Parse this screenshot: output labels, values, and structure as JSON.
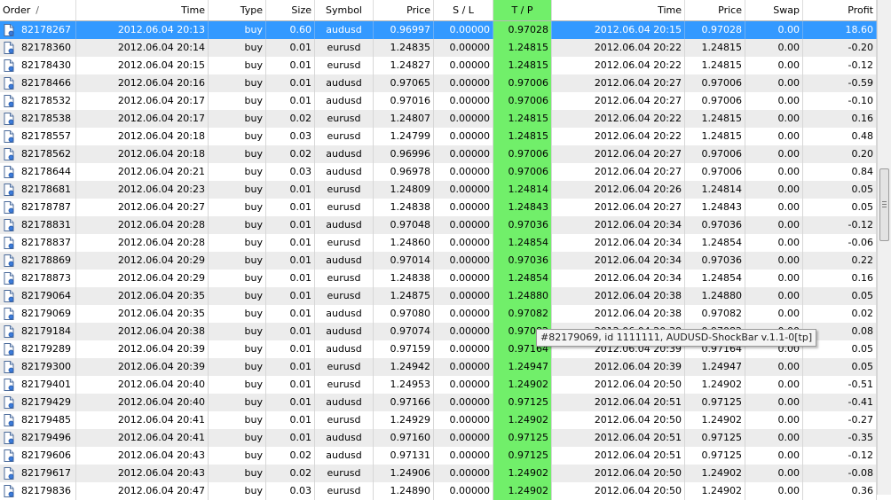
{
  "columns": [
    {
      "key": "order",
      "label": "Order",
      "sort": "/"
    },
    {
      "key": "time",
      "label": "Time"
    },
    {
      "key": "type",
      "label": "Type"
    },
    {
      "key": "size",
      "label": "Size"
    },
    {
      "key": "symbol",
      "label": "Symbol"
    },
    {
      "key": "price",
      "label": "Price"
    },
    {
      "key": "sl",
      "label": "S / L"
    },
    {
      "key": "tp",
      "label": "T / P"
    },
    {
      "key": "close_time",
      "label": "Time"
    },
    {
      "key": "close_price",
      "label": "Price"
    },
    {
      "key": "swap",
      "label": "Swap"
    },
    {
      "key": "profit",
      "label": "Profit"
    }
  ],
  "colors": {
    "selected_row": "#3399ff",
    "tp_column": "#71ef6a",
    "alt_row": "#ececec"
  },
  "selected_order": "82178267",
  "rows": [
    [
      "82178267",
      "2012.06.04 20:13",
      "buy",
      "0.60",
      "audusd",
      "0.96997",
      "0.00000",
      "0.97028",
      "2012.06.04 20:15",
      "0.97028",
      "0.00",
      "18.60"
    ],
    [
      "82178360",
      "2012.06.04 20:14",
      "buy",
      "0.01",
      "eurusd",
      "1.24835",
      "0.00000",
      "1.24815",
      "2012.06.04 20:22",
      "1.24815",
      "0.00",
      "-0.20"
    ],
    [
      "82178430",
      "2012.06.04 20:15",
      "buy",
      "0.01",
      "eurusd",
      "1.24827",
      "0.00000",
      "1.24815",
      "2012.06.04 20:22",
      "1.24815",
      "0.00",
      "-0.12"
    ],
    [
      "82178466",
      "2012.06.04 20:16",
      "buy",
      "0.01",
      "audusd",
      "0.97065",
      "0.00000",
      "0.97006",
      "2012.06.04 20:27",
      "0.97006",
      "0.00",
      "-0.59"
    ],
    [
      "82178532",
      "2012.06.04 20:17",
      "buy",
      "0.01",
      "audusd",
      "0.97016",
      "0.00000",
      "0.97006",
      "2012.06.04 20:27",
      "0.97006",
      "0.00",
      "-0.10"
    ],
    [
      "82178538",
      "2012.06.04 20:17",
      "buy",
      "0.02",
      "eurusd",
      "1.24807",
      "0.00000",
      "1.24815",
      "2012.06.04 20:22",
      "1.24815",
      "0.00",
      "0.16"
    ],
    [
      "82178557",
      "2012.06.04 20:18",
      "buy",
      "0.03",
      "eurusd",
      "1.24799",
      "0.00000",
      "1.24815",
      "2012.06.04 20:22",
      "1.24815",
      "0.00",
      "0.48"
    ],
    [
      "82178562",
      "2012.06.04 20:18",
      "buy",
      "0.02",
      "audusd",
      "0.96996",
      "0.00000",
      "0.97006",
      "2012.06.04 20:27",
      "0.97006",
      "0.00",
      "0.20"
    ],
    [
      "82178644",
      "2012.06.04 20:21",
      "buy",
      "0.03",
      "audusd",
      "0.96978",
      "0.00000",
      "0.97006",
      "2012.06.04 20:27",
      "0.97006",
      "0.00",
      "0.84"
    ],
    [
      "82178681",
      "2012.06.04 20:23",
      "buy",
      "0.01",
      "eurusd",
      "1.24809",
      "0.00000",
      "1.24814",
      "2012.06.04 20:26",
      "1.24814",
      "0.00",
      "0.05"
    ],
    [
      "82178787",
      "2012.06.04 20:27",
      "buy",
      "0.01",
      "eurusd",
      "1.24838",
      "0.00000",
      "1.24843",
      "2012.06.04 20:27",
      "1.24843",
      "0.00",
      "0.05"
    ],
    [
      "82178831",
      "2012.06.04 20:28",
      "buy",
      "0.01",
      "audusd",
      "0.97048",
      "0.00000",
      "0.97036",
      "2012.06.04 20:34",
      "0.97036",
      "0.00",
      "-0.12"
    ],
    [
      "82178837",
      "2012.06.04 20:28",
      "buy",
      "0.01",
      "eurusd",
      "1.24860",
      "0.00000",
      "1.24854",
      "2012.06.04 20:34",
      "1.24854",
      "0.00",
      "-0.06"
    ],
    [
      "82178869",
      "2012.06.04 20:29",
      "buy",
      "0.01",
      "audusd",
      "0.97014",
      "0.00000",
      "0.97036",
      "2012.06.04 20:34",
      "0.97036",
      "0.00",
      "0.22"
    ],
    [
      "82178873",
      "2012.06.04 20:29",
      "buy",
      "0.01",
      "eurusd",
      "1.24838",
      "0.00000",
      "1.24854",
      "2012.06.04 20:34",
      "1.24854",
      "0.00",
      "0.16"
    ],
    [
      "82179064",
      "2012.06.04 20:35",
      "buy",
      "0.01",
      "eurusd",
      "1.24875",
      "0.00000",
      "1.24880",
      "2012.06.04 20:38",
      "1.24880",
      "0.00",
      "0.05"
    ],
    [
      "82179069",
      "2012.06.04 20:35",
      "buy",
      "0.01",
      "audusd",
      "0.97080",
      "0.00000",
      "0.97082",
      "2012.06.04 20:38",
      "0.97082",
      "0.00",
      "0.02"
    ],
    [
      "82179184",
      "2012.06.04 20:38",
      "buy",
      "0.01",
      "audusd",
      "0.97074",
      "0.00000",
      "0.97082",
      "2012.06.04 20:38",
      "0.97082",
      "0.00",
      "0.08"
    ],
    [
      "82179289",
      "2012.06.04 20:39",
      "buy",
      "0.01",
      "audusd",
      "0.97159",
      "0.00000",
      "0.97164",
      "2012.06.04 20:39",
      "0.97164",
      "0.00",
      "0.05"
    ],
    [
      "82179300",
      "2012.06.04 20:39",
      "buy",
      "0.01",
      "eurusd",
      "1.24942",
      "0.00000",
      "1.24947",
      "2012.06.04 20:39",
      "1.24947",
      "0.00",
      "0.05"
    ],
    [
      "82179401",
      "2012.06.04 20:40",
      "buy",
      "0.01",
      "eurusd",
      "1.24953",
      "0.00000",
      "1.24902",
      "2012.06.04 20:50",
      "1.24902",
      "0.00",
      "-0.51"
    ],
    [
      "82179429",
      "2012.06.04 20:40",
      "buy",
      "0.01",
      "audusd",
      "0.97166",
      "0.00000",
      "0.97125",
      "2012.06.04 20:51",
      "0.97125",
      "0.00",
      "-0.41"
    ],
    [
      "82179485",
      "2012.06.04 20:41",
      "buy",
      "0.01",
      "eurusd",
      "1.24929",
      "0.00000",
      "1.24902",
      "2012.06.04 20:50",
      "1.24902",
      "0.00",
      "-0.27"
    ],
    [
      "82179496",
      "2012.06.04 20:41",
      "buy",
      "0.01",
      "audusd",
      "0.97160",
      "0.00000",
      "0.97125",
      "2012.06.04 20:51",
      "0.97125",
      "0.00",
      "-0.35"
    ],
    [
      "82179606",
      "2012.06.04 20:43",
      "buy",
      "0.02",
      "audusd",
      "0.97131",
      "0.00000",
      "0.97125",
      "2012.06.04 20:51",
      "0.97125",
      "0.00",
      "-0.12"
    ],
    [
      "82179617",
      "2012.06.04 20:43",
      "buy",
      "0.02",
      "eurusd",
      "1.24906",
      "0.00000",
      "1.24902",
      "2012.06.04 20:50",
      "1.24902",
      "0.00",
      "-0.08"
    ],
    [
      "82179836",
      "2012.06.04 20:47",
      "buy",
      "0.03",
      "eurusd",
      "1.24890",
      "0.00000",
      "1.24902",
      "2012.06.04 20:50",
      "1.24902",
      "0.00",
      "0.36"
    ]
  ],
  "tooltip": {
    "text": "#82179069, id 1111111, AUDUSD-ShockBar v.1.1-0[tp]"
  },
  "icons": {
    "row_icon": "document-icon"
  }
}
